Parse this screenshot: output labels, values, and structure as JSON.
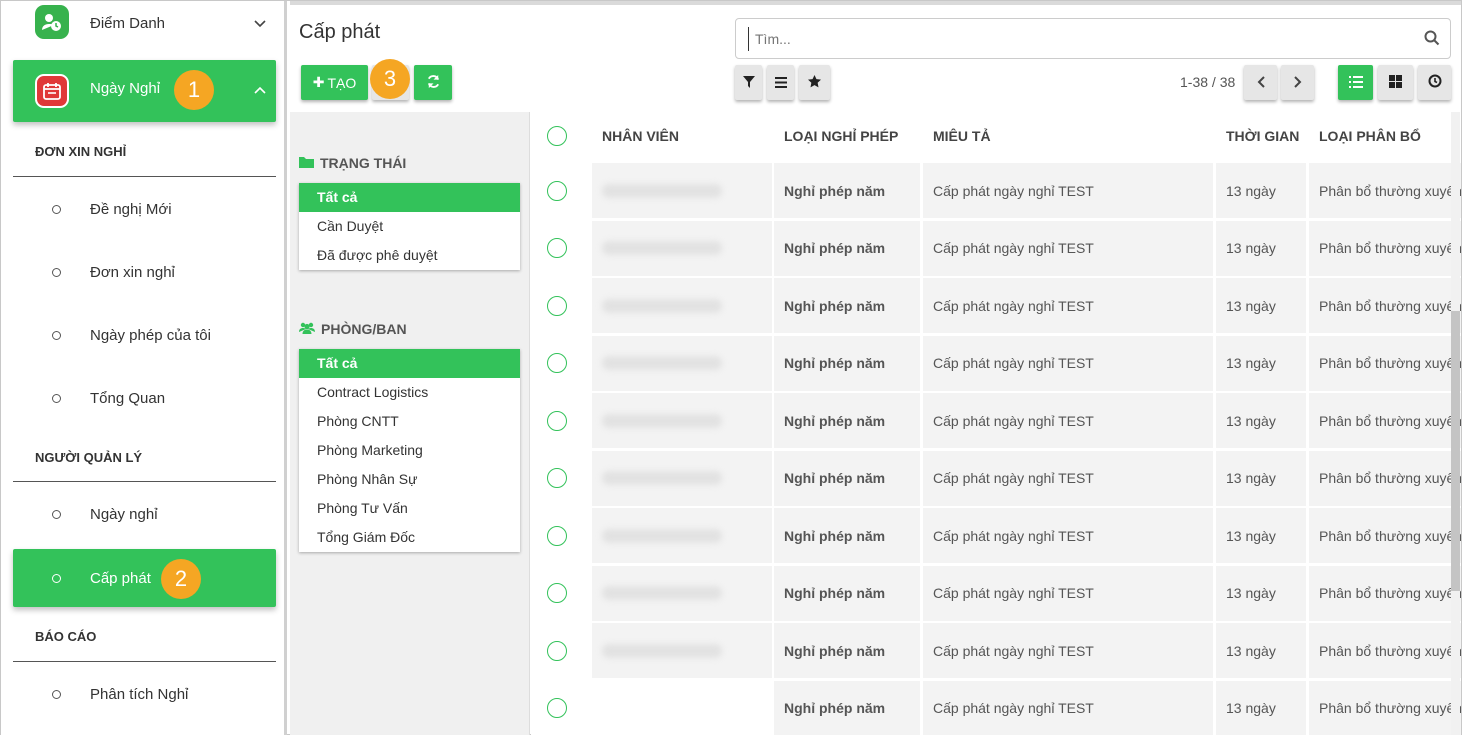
{
  "sidebar": {
    "top_app": {
      "label": "Điểm Danh"
    },
    "active_app": {
      "label": "Ngày Nghỉ",
      "badge": "1"
    },
    "sections": [
      {
        "title": "ĐƠN XIN NGHỈ",
        "items": [
          "Đề nghị Mới",
          "Đơn xin nghỉ",
          "Ngày phép của tôi",
          "Tổng Quan"
        ]
      },
      {
        "title": "NGƯỜI QUẢN LÝ",
        "items": [
          "Ngày nghỉ",
          "Cấp phát"
        ]
      },
      {
        "title": "BÁO CÁO",
        "items": [
          "Phân tích Nghỉ"
        ]
      }
    ],
    "active_item_badge": "2"
  },
  "main": {
    "title": "Cấp phát",
    "search_placeholder": "Tìm...",
    "create_label": "TẠO",
    "create_badge": "3",
    "pager": "1-38 / 38"
  },
  "panel": {
    "status": {
      "title": "TRẠNG THÁI",
      "options": [
        "Tất cả",
        "Cần Duyệt",
        "Đã được phê duyệt"
      ]
    },
    "department": {
      "title": "PHÒNG/BAN",
      "options": [
        "Tất cả",
        "Contract Logistics",
        "Phòng CNTT",
        "Phòng Marketing",
        "Phòng Nhân Sự",
        "Phòng Tư Vấn",
        "Tổng Giám Đốc"
      ]
    }
  },
  "table": {
    "columns": [
      "NHÂN VIÊN",
      "LOẠI NGHỈ PHÉP",
      "MIÊU TẢ",
      "THỜI GIAN",
      "LOẠI PHÂN BỔ"
    ],
    "rows": [
      {
        "leave_type": "Nghỉ phép năm",
        "description": "Cấp phát ngày nghỉ TEST",
        "duration": "13 ngày",
        "allocation": "Phân bổ thường xuyên"
      },
      {
        "leave_type": "Nghỉ phép năm",
        "description": "Cấp phát ngày nghỉ TEST",
        "duration": "13 ngày",
        "allocation": "Phân bổ thường xuyên"
      },
      {
        "leave_type": "Nghỉ phép năm",
        "description": "Cấp phát ngày nghỉ TEST",
        "duration": "13 ngày",
        "allocation": "Phân bổ thường xuyên"
      },
      {
        "leave_type": "Nghỉ phép năm",
        "description": "Cấp phát ngày nghỉ TEST",
        "duration": "13 ngày",
        "allocation": "Phân bổ thường xuyên"
      },
      {
        "leave_type": "Nghỉ phép năm",
        "description": "Cấp phát ngày nghỉ TEST",
        "duration": "13 ngày",
        "allocation": "Phân bổ thường xuyên"
      },
      {
        "leave_type": "Nghỉ phép năm",
        "description": "Cấp phát ngày nghỉ TEST",
        "duration": "13 ngày",
        "allocation": "Phân bổ thường xuyên"
      },
      {
        "leave_type": "Nghỉ phép năm",
        "description": "Cấp phát ngày nghỉ TEST",
        "duration": "13 ngày",
        "allocation": "Phân bổ thường xuyên"
      },
      {
        "leave_type": "Nghỉ phép năm",
        "description": "Cấp phát ngày nghỉ TEST",
        "duration": "13 ngày",
        "allocation": "Phân bổ thường xuyên"
      },
      {
        "leave_type": "Nghỉ phép năm",
        "description": "Cấp phát ngày nghỉ TEST",
        "duration": "13 ngày",
        "allocation": "Phân bổ thường xuyên"
      },
      {
        "leave_type": "Nghỉ phép năm",
        "description": "Cấp phát ngày nghỉ TEST",
        "duration": "13 ngày",
        "allocation": "Phân bổ thường xuyên"
      }
    ]
  },
  "colors": {
    "accent": "#33c25a",
    "badge": "#f5a623"
  }
}
